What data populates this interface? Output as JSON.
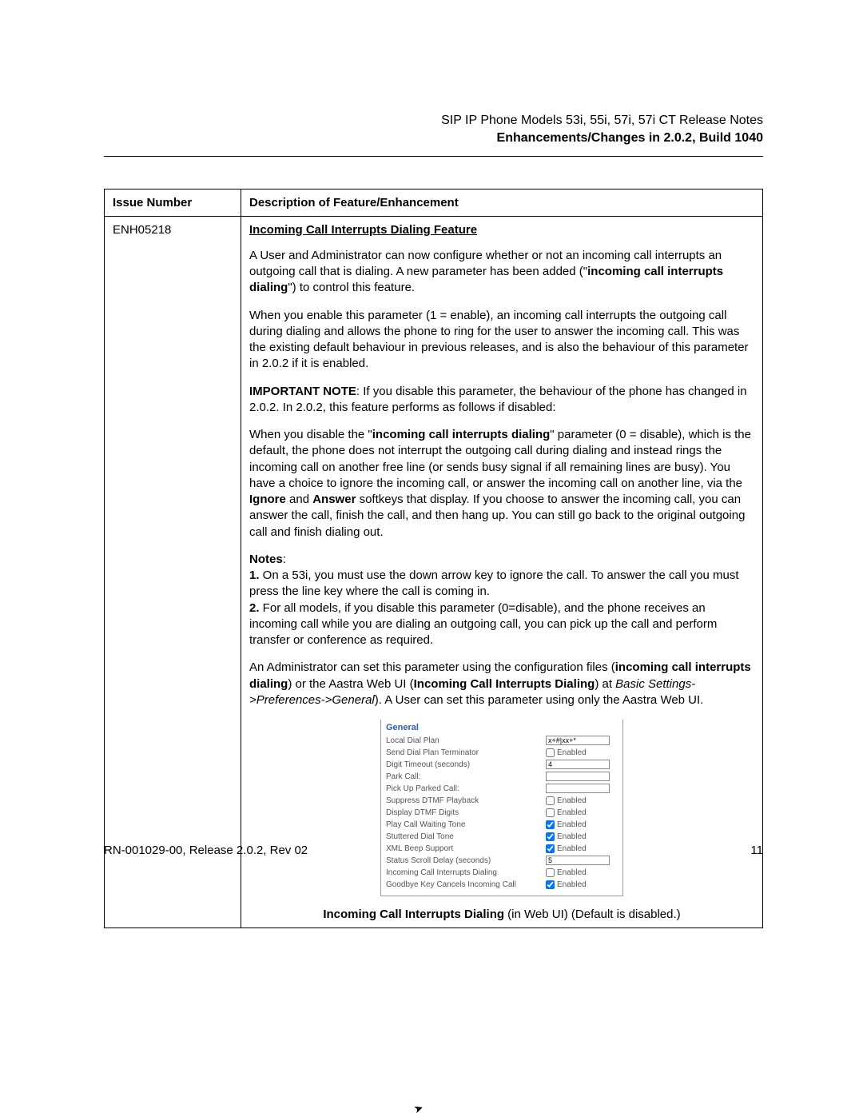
{
  "header": {
    "title": "SIP IP Phone Models 53i, 55i, 57i, 57i CT Release Notes",
    "subtitle": "Enhancements/Changes in 2.0.2, Build 1040"
  },
  "table": {
    "col1_header": "Issue Number",
    "col2_header": "Description of Feature/Enhancement",
    "issue_number": "ENH05218",
    "feature_title": "Incoming Call Interrupts Dialing Feature",
    "p1_a": "A User and Administrator can now configure whether or not an incoming call interrupts an outgoing call that is dialing. A new parameter has been added (\"",
    "p1_b": "incoming call interrupts dialing",
    "p1_c": "\") to control this feature.",
    "p2": "When you enable this parameter (1 = enable), an incoming call interrupts the outgoing call during dialing and allows the phone to ring for the user to answer the incoming call. This was the existing default behaviour in previous releases, and is also the behaviour of this parameter in 2.0.2 if it is enabled.",
    "p3_a": "IMPORTANT NOTE",
    "p3_b": ": If you disable this parameter, the behaviour of the phone has changed in 2.0.2. In 2.0.2, this feature performs as follows if disabled:",
    "p4_a": "When you disable the \"",
    "p4_b": "incoming call interrupts dialing",
    "p4_c": "\" parameter (0 = disable), which is the default, the phone does not interrupt the outgoing call during dialing and instead rings the incoming call on another free line (or sends busy signal if all remaining lines are busy). You have a choice to ignore the incoming call, or answer the incoming call on another line, via the ",
    "p4_d": "Ignore",
    "p4_e": " and ",
    "p4_f": "Answer",
    "p4_g": " softkeys that display. If you choose to answer the incoming call, you can answer the call, finish the call, and then hang up. You can still go back to the original outgoing call and finish dialing out.",
    "notes_label": "Notes",
    "note1_a": "1.",
    "note1_b": " On a 53i, you must use the down arrow key to ignore the call. To answer the call you must press the line key where the call is coming in.",
    "note2_a": "2.",
    "note2_b": " For all models, if you disable this parameter (0=disable), and the phone receives an incoming call while you are dialing an outgoing call, you can pick up the call and perform transfer or conference as required.",
    "p6_a": "An Administrator can set this parameter using the configuration files (",
    "p6_b": "incoming call interrupts dialing",
    "p6_c": ") or the Aastra Web UI (",
    "p6_d": "Incoming Call Interrupts Dialing",
    "p6_e": ") at ",
    "p6_f": "Basic Settings->Preferences->General",
    "p6_g": "). A User can set this parameter using only the Aastra Web UI.",
    "caption_a": "Incoming Call Interrupts Dialing",
    "caption_b": " (in Web UI) (Default is disabled.)"
  },
  "settings": {
    "section": "General",
    "rows": [
      {
        "label": "Local Dial Plan",
        "type": "text",
        "value": "x+#|xx+*"
      },
      {
        "label": "Send Dial Plan Terminator",
        "type": "check",
        "checked": false,
        "text": "Enabled"
      },
      {
        "label": "Digit Timeout (seconds)",
        "type": "text",
        "value": "4"
      },
      {
        "label": "Park Call:",
        "type": "text",
        "value": ""
      },
      {
        "label": "Pick Up Parked Call:",
        "type": "text",
        "value": ""
      },
      {
        "label": "Suppress DTMF Playback",
        "type": "check",
        "checked": false,
        "text": "Enabled"
      },
      {
        "label": "Display DTMF Digits",
        "type": "check",
        "checked": false,
        "text": "Enabled"
      },
      {
        "label": "Play Call Waiting Tone",
        "type": "check",
        "checked": true,
        "text": "Enabled"
      },
      {
        "label": "Stuttered Dial Tone",
        "type": "check",
        "checked": true,
        "text": "Enabled"
      },
      {
        "label": "XML Beep Support",
        "type": "check",
        "checked": true,
        "text": "Enabled"
      },
      {
        "label": "Status Scroll Delay (seconds)",
        "type": "text",
        "value": "5"
      },
      {
        "label": "Incoming Call Interrupts Dialing",
        "type": "check",
        "checked": false,
        "text": "Enabled"
      },
      {
        "label": "Goodbye Key Cancels Incoming Call",
        "type": "check",
        "checked": true,
        "text": "Enabled"
      }
    ]
  },
  "footer": {
    "left": "RN-001029-00, Release 2.0.2, Rev 02",
    "right": "11"
  }
}
